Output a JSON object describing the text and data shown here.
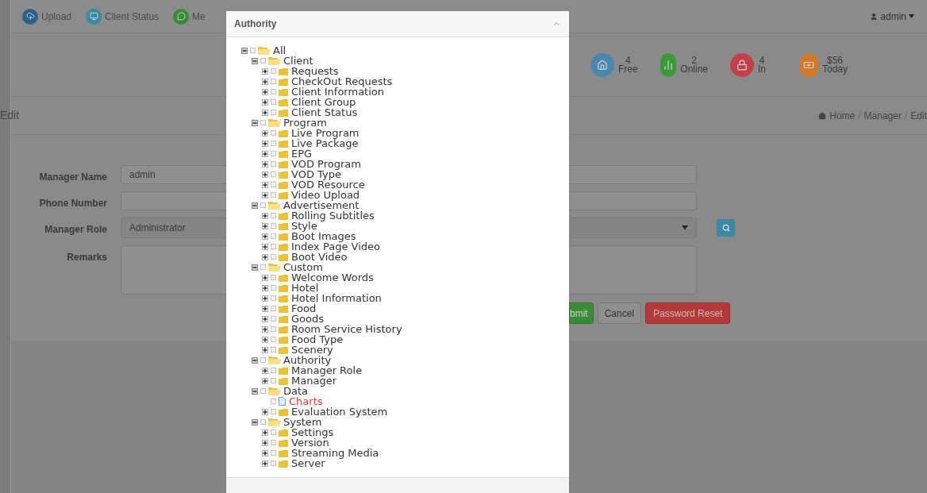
{
  "nav": {
    "items": [
      {
        "label": "Upload",
        "color": "#2c5f8a"
      },
      {
        "label": "Client Status",
        "color": "#3a8aa5"
      },
      {
        "label": "Me",
        "color": "#3a8a3a"
      }
    ],
    "user": "admin"
  },
  "stats": [
    {
      "value": "4",
      "label": "Free",
      "color": "#4a86ad"
    },
    {
      "value": "2",
      "label": "Online",
      "color": "#3a9a3a"
    },
    {
      "value": "4",
      "label": "In",
      "color": "#c2404a"
    },
    {
      "value": "$56",
      "label": "Today",
      "color": "#d2782a"
    }
  ],
  "page_title": "Edit",
  "breadcrumb": [
    "Home",
    "/",
    "Manager",
    "/",
    "Edit"
  ],
  "form": [
    {
      "label": "Manager Name",
      "kind": "input",
      "value": "admin"
    },
    {
      "label": "Phone Number",
      "kind": "input"
    },
    {
      "label": "Manager Role",
      "kind": "select",
      "value": "Administrator"
    },
    {
      "label": "Remarks",
      "kind": "textarea"
    }
  ],
  "buttons": [
    {
      "label": "bmit",
      "kind": "submit"
    },
    {
      "label": "Cancel",
      "kind": "cancel"
    },
    {
      "label": "Password Reset",
      "kind": "danger"
    }
  ],
  "dialog": {
    "title": "Authority",
    "tree": [
      {
        "label": "All",
        "kind": "folder",
        "expanded": true,
        "selected": false,
        "children": [
          {
            "label": "Client",
            "kind": "folder",
            "expanded": true,
            "selected": false,
            "children": [
              {
                "label": "Requests",
                "kind": "folder",
                "expanded": false,
                "selected": false
              },
              {
                "label": "CheckOut Requests",
                "kind": "folder",
                "expanded": false,
                "selected": false
              },
              {
                "label": "Client Information",
                "kind": "folder",
                "expanded": false,
                "selected": false
              },
              {
                "label": "Client Group",
                "kind": "folder",
                "expanded": false,
                "selected": false
              },
              {
                "label": "Client Status",
                "kind": "folder",
                "expanded": false,
                "selected": false
              }
            ]
          },
          {
            "label": "Program",
            "kind": "folder",
            "expanded": true,
            "selected": false,
            "children": [
              {
                "label": "Live Program",
                "kind": "folder",
                "expanded": false,
                "selected": false
              },
              {
                "label": "Live Package",
                "kind": "folder",
                "expanded": false,
                "selected": false
              },
              {
                "label": "EPG",
                "kind": "folder",
                "expanded": false,
                "selected": false
              },
              {
                "label": "VOD Program",
                "kind": "folder",
                "expanded": false,
                "selected": false
              },
              {
                "label": "VOD Type",
                "kind": "folder",
                "expanded": false,
                "selected": false
              },
              {
                "label": "VOD Resource",
                "kind": "folder",
                "expanded": false,
                "selected": false
              },
              {
                "label": "Video Upload",
                "kind": "folder",
                "expanded": false,
                "selected": false
              }
            ]
          },
          {
            "label": "Advertisement",
            "kind": "folder",
            "expanded": true,
            "selected": false,
            "children": [
              {
                "label": "Rolling Subtitles",
                "kind": "folder",
                "expanded": false,
                "selected": false
              },
              {
                "label": "Style",
                "kind": "folder",
                "expanded": false,
                "selected": false
              },
              {
                "label": "Boot Images",
                "kind": "folder",
                "expanded": false,
                "selected": false
              },
              {
                "label": "Index Page Video",
                "kind": "folder",
                "expanded": false,
                "selected": false
              },
              {
                "label": "Boot Video",
                "kind": "folder",
                "expanded": false,
                "selected": false
              }
            ]
          },
          {
            "label": "Custom",
            "kind": "folder",
            "expanded": true,
            "selected": false,
            "children": [
              {
                "label": "Welcome Words",
                "kind": "folder",
                "expanded": false,
                "selected": false
              },
              {
                "label": "Hotel",
                "kind": "folder",
                "expanded": false,
                "selected": false
              },
              {
                "label": "Hotel Information",
                "kind": "folder",
                "expanded": false,
                "selected": false
              },
              {
                "label": "Food",
                "kind": "folder",
                "expanded": false,
                "selected": false
              },
              {
                "label": "Goods",
                "kind": "folder",
                "expanded": false,
                "selected": false
              },
              {
                "label": "Room Service History",
                "kind": "folder",
                "expanded": false,
                "selected": false
              },
              {
                "label": "Food Type",
                "kind": "folder",
                "expanded": false,
                "selected": false
              },
              {
                "label": "Scenery",
                "kind": "folder",
                "expanded": false,
                "selected": false
              }
            ]
          },
          {
            "label": "Authority",
            "kind": "folder",
            "expanded": true,
            "selected": false,
            "children": [
              {
                "label": "Manager Role",
                "kind": "folder",
                "expanded": false,
                "selected": false
              },
              {
                "label": "Manager",
                "kind": "folder",
                "expanded": false,
                "selected": false
              }
            ]
          },
          {
            "label": "Data",
            "kind": "folder",
            "expanded": true,
            "selected": false,
            "children": [
              {
                "label": "Charts",
                "kind": "file",
                "expanded": false,
                "selected": true
              },
              {
                "label": "Evaluation System",
                "kind": "folder",
                "expanded": false,
                "selected": false
              }
            ]
          },
          {
            "label": "System",
            "kind": "folder",
            "expanded": true,
            "selected": false,
            "children": [
              {
                "label": "Settings",
                "kind": "folder",
                "expanded": false,
                "selected": false
              },
              {
                "label": "Version",
                "kind": "folder",
                "expanded": false,
                "selected": false
              },
              {
                "label": "Streaming Media",
                "kind": "folder",
                "expanded": false,
                "selected": false
              },
              {
                "label": "Server",
                "kind": "folder",
                "expanded": false,
                "selected": false
              }
            ]
          }
        ]
      }
    ]
  }
}
